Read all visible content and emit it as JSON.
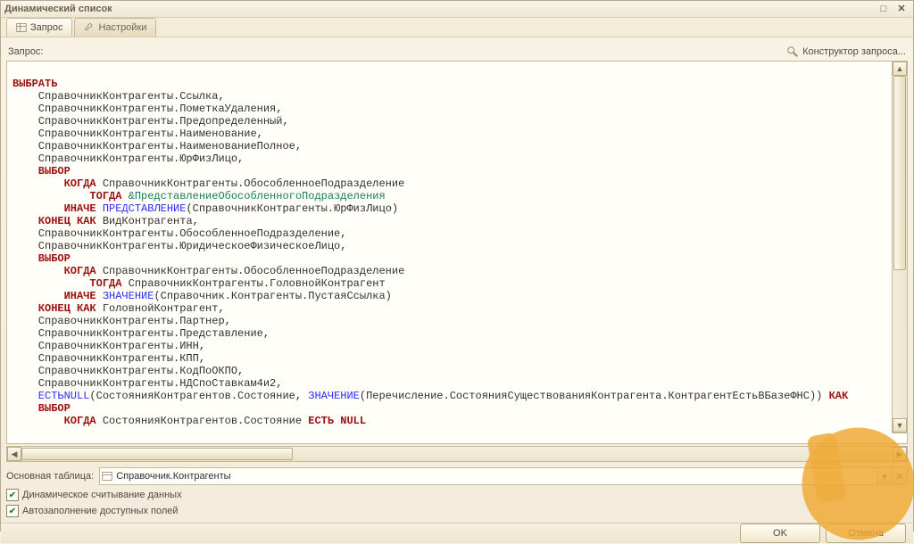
{
  "title": "Динамический список",
  "tabs": {
    "query": "Запрос",
    "settings": "Настройки"
  },
  "label_query": "Запрос:",
  "constructor_link": "Конструктор запроса...",
  "main_table_label": "Основная таблица:",
  "main_table_value": "Справочник.Контрагенты",
  "chk_dynamic": "Динамическое считывание данных",
  "chk_autofill": "Автозаполнение доступных полей",
  "btn_ok": "OK",
  "btn_cancel": "Отмена",
  "code": {
    "l01_kw": "ВЫБРАТЬ",
    "l02": "    СправочникКонтрагенты.Ссылка,",
    "l03": "    СправочникКонтрагенты.ПометкаУдаления,",
    "l04": "    СправочникКонтрагенты.Предопределенный,",
    "l05": "    СправочникКонтрагенты.Наименование,",
    "l06": "    СправочникКонтрагенты.НаименованиеПолное,",
    "l07": "    СправочникКонтрагенты.ЮрФизЛицо,",
    "l08_kw": "    ВЫБОР",
    "l09_kw": "        КОГДА ",
    "l09_tx": "СправочникКонтрагенты.ОбособленноеПодразделение",
    "l10_kw": "            ТОГДА ",
    "l10_par": "&ПредставлениеОбособленногоПодразделения",
    "l11_kw": "        ИНАЧЕ ",
    "l11_fn": "ПРЕДСТАВЛЕНИЕ",
    "l11_tx": "(СправочникКонтрагенты.ЮрФизЛицо)",
    "l12_kw": "    КОНЕЦ КАК ",
    "l12_tx": "ВидКонтрагента,",
    "l13": "    СправочникКонтрагенты.ОбособленноеПодразделение,",
    "l14": "    СправочникКонтрагенты.ЮридическоеФизическоеЛицо,",
    "l15_kw": "    ВЫБОР",
    "l16_kw": "        КОГДА ",
    "l16_tx": "СправочникКонтрагенты.ОбособленноеПодразделение",
    "l17_kw": "            ТОГДА ",
    "l17_tx": "СправочникКонтрагенты.ГоловнойКонтрагент",
    "l18_kw": "        ИНАЧЕ ",
    "l18_fn": "ЗНАЧЕНИЕ",
    "l18_tx": "(Справочник.Контрагенты.ПустаяСсылка)",
    "l19_kw": "    КОНЕЦ КАК ",
    "l19_tx": "ГоловнойКонтрагент,",
    "l20": "    СправочникКонтрагенты.Партнер,",
    "l21": "    СправочникКонтрагенты.Представление,",
    "l22": "    СправочникКонтрагенты.ИНН,",
    "l23": "    СправочникКонтрагенты.КПП,",
    "l24": "    СправочникКонтрагенты.КодПоОКПО,",
    "l25": "    СправочникКонтрагенты.НДСпоСтавкам4и2,",
    "l26_fn1": "    ЕСТЬNULL",
    "l26_tx1": "(СостоянияКонтрагентов.Состояние, ",
    "l26_fn2": "ЗНАЧЕНИЕ",
    "l26_tx2": "(Перечисление.СостоянияСуществованияКонтрагента.КонтрагентЕстьВБазеФНС)) ",
    "l26_kw": "КАК",
    "l27_kw": "    ВЫБОР",
    "l28_kw": "        КОГДА ",
    "l28_tx": "СостоянияКонтрагентов.Состояние ",
    "l28_kw2": "ЕСТЬ NULL"
  }
}
